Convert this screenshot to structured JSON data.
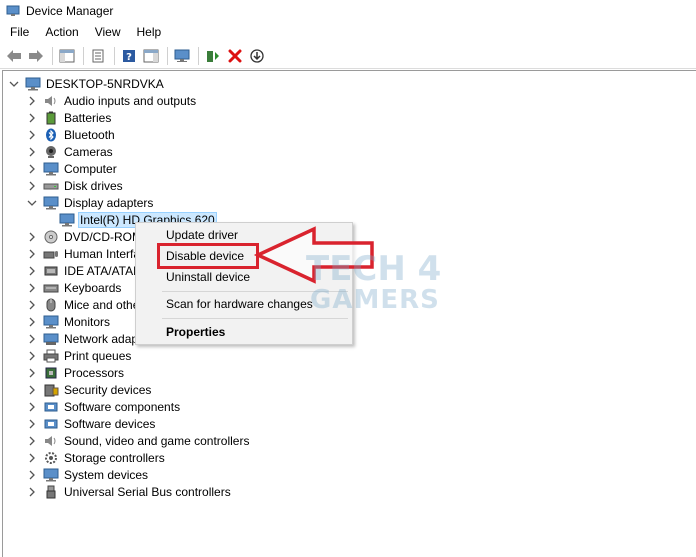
{
  "window": {
    "title": "Device Manager"
  },
  "menu": [
    "File",
    "Action",
    "View",
    "Help"
  ],
  "tree": {
    "root": "DESKTOP-5NRDVKA",
    "items": [
      "Audio inputs and outputs",
      "Batteries",
      "Bluetooth",
      "Cameras",
      "Computer",
      "Disk drives",
      "Display adapters",
      "Intel(R) HD Graphics 620",
      "DVD/CD-ROM",
      "Human Interfa",
      "IDE ATA/ATAPI",
      "Keyboards",
      "Mice and othe",
      "Monitors",
      "Network adap",
      "Print queues",
      "Processors",
      "Security devices",
      "Software components",
      "Software devices",
      "Sound, video and game controllers",
      "Storage controllers",
      "System devices",
      "Universal Serial Bus controllers"
    ]
  },
  "context_menu": {
    "update_driver": "Update driver",
    "disable_device": "Disable device",
    "uninstall_device": "Uninstall device",
    "scan": "Scan for hardware changes",
    "properties": "Properties"
  },
  "watermark": {
    "line1": "TECH 4",
    "line2": "GAMERS"
  },
  "colors": {
    "accent": "#d9232e",
    "selection": "#cce8ff",
    "watermark": "#7aa9c9"
  }
}
